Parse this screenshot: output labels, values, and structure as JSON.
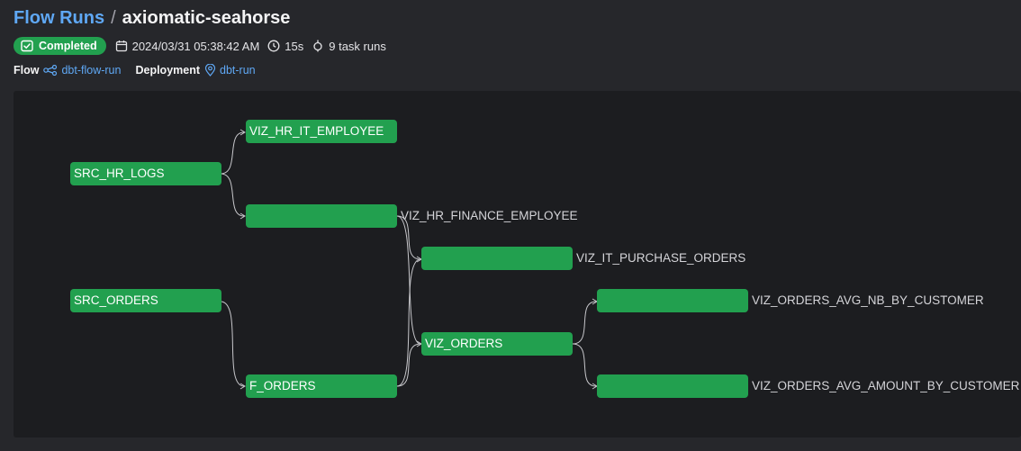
{
  "breadcrumb": {
    "parent": "Flow Runs",
    "separator": "/",
    "current": "axiomatic-seahorse"
  },
  "status": {
    "label": "Completed",
    "color": "#22a04f",
    "icon": "check-square-icon"
  },
  "meta": {
    "start_time": "2024/03/31 05:38:42 AM",
    "duration": "15s",
    "task_runs": "9 task runs"
  },
  "info": {
    "flow_label": "Flow",
    "flow_name": "dbt-flow-run",
    "deployment_label": "Deployment",
    "deployment_name": "dbt-run"
  },
  "graph": {
    "nodes": [
      {
        "id": "viz_hr_it_employee",
        "inside": "VIZ_HR_IT_EMPLOYEE",
        "outside": ""
      },
      {
        "id": "src_hr_logs",
        "inside": "SRC_HR_LOGS",
        "outside": ""
      },
      {
        "id": "viz_hr_finance_employee",
        "inside": "",
        "outside": "VIZ_HR_FINANCE_EMPLOYEE"
      },
      {
        "id": "viz_it_purchase_orders",
        "inside": "",
        "outside": "VIZ_IT_PURCHASE_ORDERS"
      },
      {
        "id": "src_orders",
        "inside": "SRC_ORDERS",
        "outside": ""
      },
      {
        "id": "viz_orders_avg_nb_by_customer",
        "inside": "",
        "outside": "VIZ_ORDERS_AVG_NB_BY_CUSTOMER"
      },
      {
        "id": "viz_orders",
        "inside": "VIZ_ORDERS",
        "outside": ""
      },
      {
        "id": "f_orders",
        "inside": "F_ORDERS",
        "outside": ""
      },
      {
        "id": "viz_orders_avg_amount_by_customer",
        "inside": "",
        "outside": "VIZ_ORDERS_AVG_AMOUNT_BY_CUSTOMER"
      }
    ],
    "node_color": "#22a04f"
  }
}
